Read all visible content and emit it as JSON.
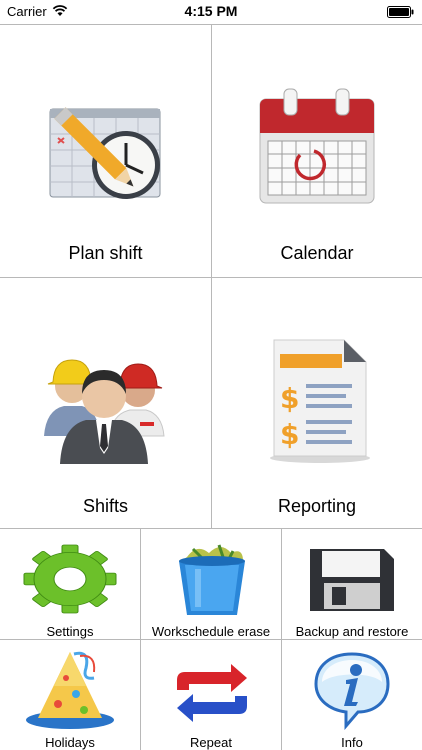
{
  "status_bar": {
    "carrier": "Carrier",
    "time": "4:15 PM"
  },
  "menu": {
    "large": [
      {
        "label": "Plan shift",
        "icon": "plan-shift-icon"
      },
      {
        "label": "Calendar",
        "icon": "calendar-icon"
      },
      {
        "label": "Shifts",
        "icon": "workers-icon"
      },
      {
        "label": "Reporting",
        "icon": "report-icon"
      }
    ],
    "small": [
      {
        "label": "Settings",
        "icon": "gear-icon"
      },
      {
        "label": "Workschedule erase",
        "icon": "trash-bin-icon"
      },
      {
        "label": "Backup and restore",
        "icon": "floppy-disk-icon"
      },
      {
        "label": "Holidays",
        "icon": "party-hat-icon"
      },
      {
        "label": "Repeat",
        "icon": "repeat-arrows-icon"
      },
      {
        "label": "Info",
        "icon": "info-icon"
      }
    ]
  },
  "colors": {
    "calendar_red": "#c0282d",
    "gear_green": "#6cc02a",
    "bin_blue": "#2a86d8",
    "repeat_red": "#d8242a",
    "repeat_blue": "#2850c8",
    "info_blue": "#3a7cd8"
  }
}
